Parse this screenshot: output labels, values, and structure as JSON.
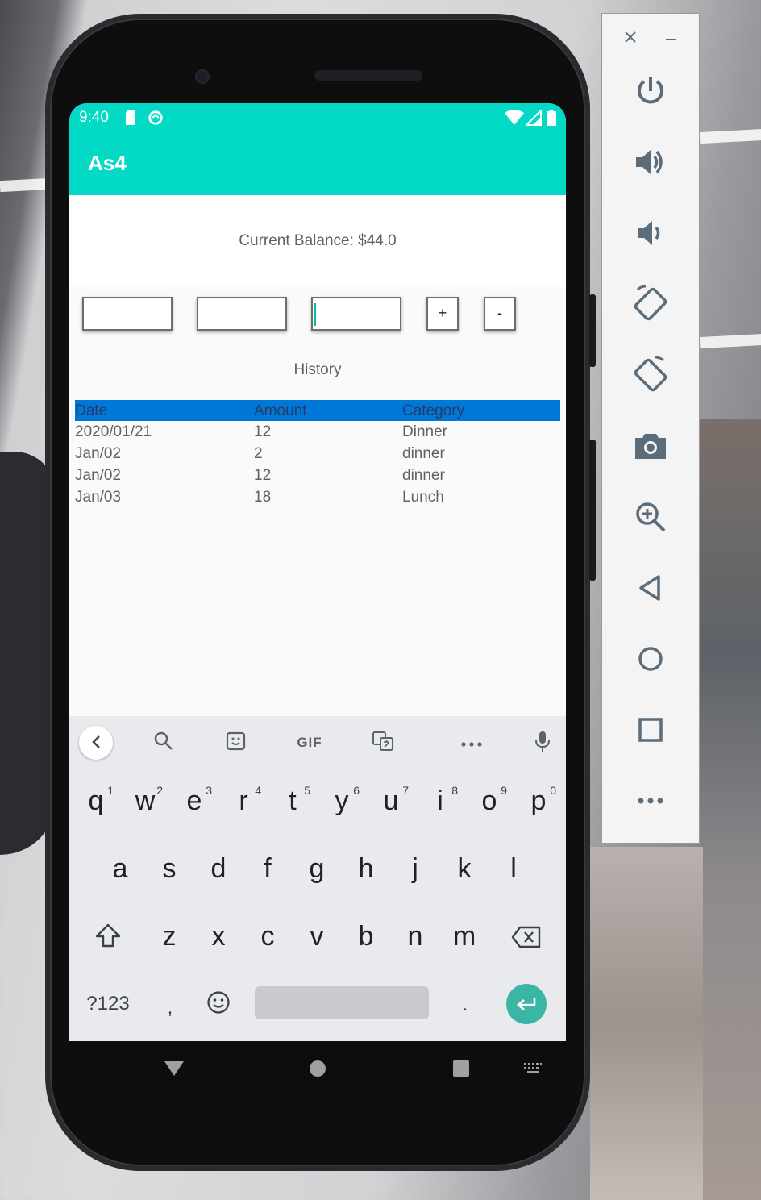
{
  "status_bar": {
    "time": "9:40"
  },
  "app_bar": {
    "title": "As4"
  },
  "balance": {
    "text": "Current Balance: $44.0"
  },
  "form": {
    "plus_label": "+",
    "minus_label": "-"
  },
  "history": {
    "title": "History",
    "columns": [
      "Date",
      "Amount",
      "Category"
    ],
    "rows": [
      [
        "2020/01/21",
        "12",
        "Dinner"
      ],
      [
        "Jan/02",
        "2",
        "dinner"
      ],
      [
        "Jan/02",
        "12",
        "dinner"
      ],
      [
        "Jan/03",
        "18",
        "Lunch"
      ]
    ]
  },
  "keyboard": {
    "toolbar": {
      "gif_label": "GIF"
    },
    "row1": [
      {
        "key": "q",
        "hint": "1"
      },
      {
        "key": "w",
        "hint": "2"
      },
      {
        "key": "e",
        "hint": "3"
      },
      {
        "key": "r",
        "hint": "4"
      },
      {
        "key": "t",
        "hint": "5"
      },
      {
        "key": "y",
        "hint": "6"
      },
      {
        "key": "u",
        "hint": "7"
      },
      {
        "key": "i",
        "hint": "8"
      },
      {
        "key": "o",
        "hint": "9"
      },
      {
        "key": "p",
        "hint": "0"
      }
    ],
    "row2": [
      "a",
      "s",
      "d",
      "f",
      "g",
      "h",
      "j",
      "k",
      "l"
    ],
    "row3": [
      "z",
      "x",
      "c",
      "v",
      "b",
      "n",
      "m"
    ],
    "symbols_label": "?123",
    "comma_label": ",",
    "period_label": "."
  },
  "colors": {
    "accent": "#03dac5",
    "table_header": "#0078d7",
    "enter_key": "#3bb5a4"
  },
  "emulator_panel": {
    "buttons": [
      "power-icon",
      "volume-up-icon",
      "volume-down-icon",
      "rotate-left-icon",
      "rotate-right-icon",
      "camera-icon",
      "zoom-icon",
      "back-icon",
      "home-icon",
      "overview-icon",
      "more-icon"
    ]
  }
}
